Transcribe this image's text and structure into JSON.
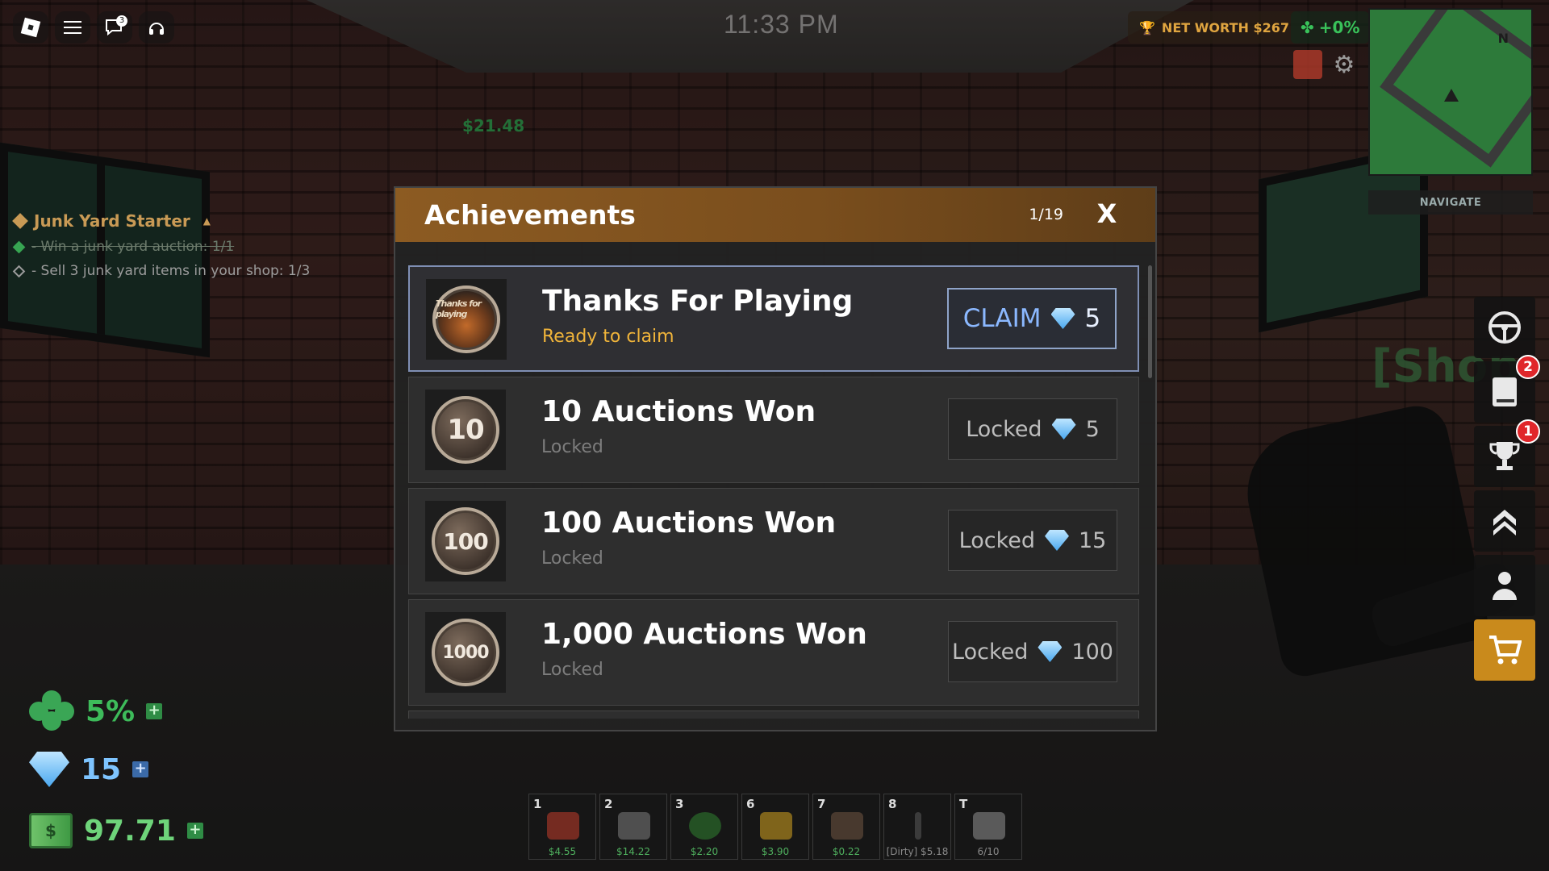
{
  "topbar": {
    "clock": "11:33 PM",
    "notifications_count": "3",
    "net_worth": "NET WORTH $267",
    "luck_bonus": "+0%"
  },
  "minimap": {
    "north_label": "N",
    "navigate_label": "NAVIGATE"
  },
  "world": {
    "floating_price": "$21.48",
    "shop_sign": "[Shop"
  },
  "quest": {
    "title": "Junk Yard Starter",
    "objectives": [
      {
        "text": "- Win a junk yard auction: 1/1",
        "done": true
      },
      {
        "text": "- Sell 3 junk yard items in your shop: 1/3",
        "done": false
      }
    ]
  },
  "stats": {
    "luck": "5%",
    "gems": "15",
    "cash": "97.71"
  },
  "side_buttons": {
    "quests_badge": "2",
    "trophy_badge": "1"
  },
  "hotbar": [
    {
      "key": "1",
      "price": "$4.55",
      "color": "#b53a2a"
    },
    {
      "key": "2",
      "price": "$14.22",
      "color": "#777777"
    },
    {
      "key": "3",
      "price": "$2.20",
      "color": "#2f7a2f"
    },
    {
      "key": "6",
      "price": "$3.90",
      "color": "#c79a20"
    },
    {
      "key": "7",
      "price": "$0.22",
      "color": "#6a5240"
    },
    {
      "key": "8",
      "price": "[Dirty] $5.18",
      "color": "#555555"
    },
    {
      "key": "T",
      "price": "6/10",
      "color": "#888888"
    }
  ],
  "modal": {
    "title": "Achievements",
    "page": "1/19",
    "close": "X",
    "items": [
      {
        "medal": "Thanks for playing",
        "title": "Thanks For Playing",
        "status": "Ready to claim",
        "button": "CLAIM",
        "reward": "5"
      },
      {
        "medal": "10",
        "title": "10 Auctions Won",
        "status": "Locked",
        "button": "Locked",
        "reward": "5"
      },
      {
        "medal": "100",
        "title": "100 Auctions Won",
        "status": "Locked",
        "button": "Locked",
        "reward": "15"
      },
      {
        "medal": "1000",
        "title": "1,000 Auctions Won",
        "status": "Locked",
        "button": "Locked",
        "reward": "100"
      }
    ]
  }
}
